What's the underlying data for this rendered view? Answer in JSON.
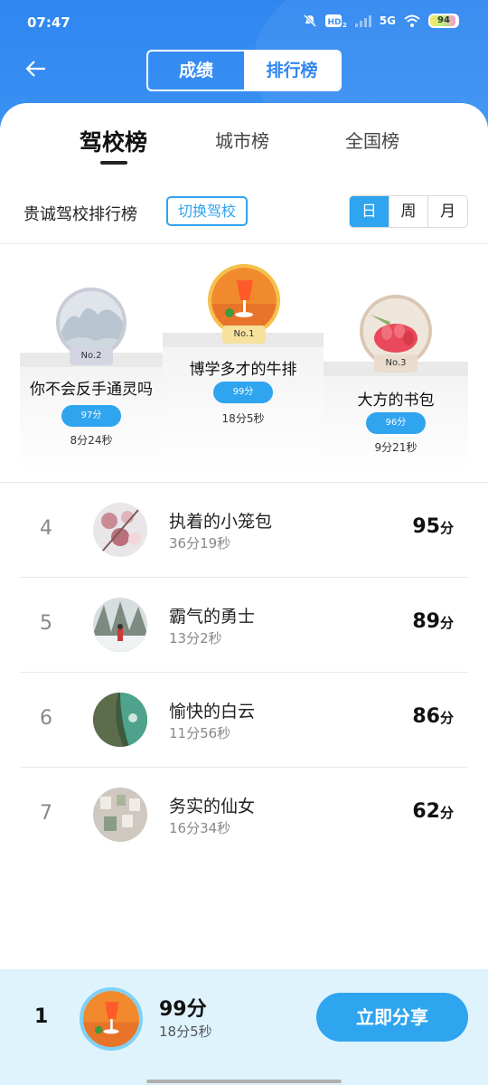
{
  "status_bar": {
    "time": "07:47",
    "icons": [
      "bell-off-icon",
      "hd-icon",
      "signal-icon",
      "wifi-icon"
    ],
    "network": "5G",
    "battery": "94"
  },
  "header": {
    "back_icon": "back-arrow-icon",
    "segments": [
      "成绩",
      "排行榜"
    ],
    "active_segment": "排行榜"
  },
  "tabs": {
    "items": [
      "驾校榜",
      "城市榜",
      "全国榜"
    ],
    "active": "驾校榜"
  },
  "school": {
    "name": "贵诚驾校排行榜",
    "switch_label": "切换驾校"
  },
  "period": {
    "options": [
      "日",
      "周",
      "月"
    ],
    "active": "日"
  },
  "podium": [
    {
      "rank_label": "No.1",
      "name": "博学多才的牛排",
      "score": "99分",
      "time": "18分5秒"
    },
    {
      "rank_label": "No.2",
      "name": "你不会反手通灵吗",
      "score": "97分",
      "time": "8分24秒"
    },
    {
      "rank_label": "No.3",
      "name": "大方的书包",
      "score": "96分",
      "time": "9分21秒"
    }
  ],
  "list": [
    {
      "rank": "4",
      "name": "执着的小笼包",
      "time": "36分19秒",
      "score": "95",
      "unit": "分"
    },
    {
      "rank": "5",
      "name": "霸气的勇士",
      "time": "13分2秒",
      "score": "89",
      "unit": "分"
    },
    {
      "rank": "6",
      "name": "愉快的白云",
      "time": "11分56秒",
      "score": "86",
      "unit": "分"
    },
    {
      "rank": "7",
      "name": "务实的仙女",
      "time": "16分34秒",
      "score": "62",
      "unit": "分"
    }
  ],
  "me": {
    "rank": "1",
    "score": "99分",
    "time": "18分5秒",
    "share_label": "立即分享"
  },
  "colors": {
    "header_blue": "#2f86f0",
    "accent_blue": "#2fa4ef",
    "bottom_bg": "#dff3fd"
  }
}
